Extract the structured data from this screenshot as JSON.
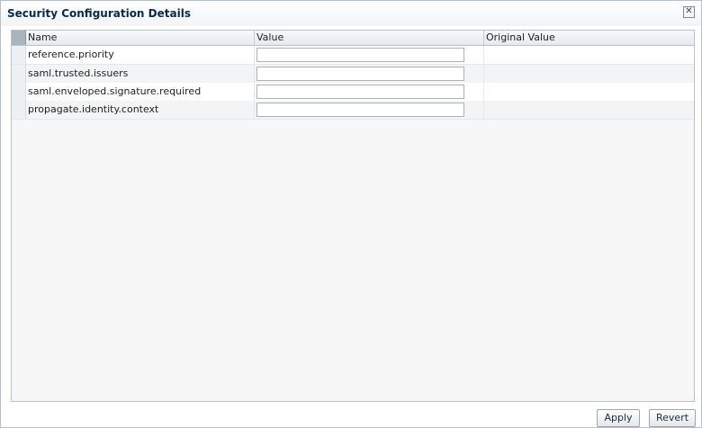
{
  "dialog": {
    "title": "Security Configuration Details",
    "close_glyph": "✕"
  },
  "table": {
    "columns": [
      "Name",
      "Value",
      "Original Value"
    ],
    "rows": [
      {
        "name": "reference.priority",
        "value": "",
        "original": ""
      },
      {
        "name": "saml.trusted.issuers",
        "value": "",
        "original": ""
      },
      {
        "name": "saml.enveloped.signature.required",
        "value": "",
        "original": ""
      },
      {
        "name": "propagate.identity.context",
        "value": "",
        "original": ""
      }
    ]
  },
  "buttons": {
    "apply": "Apply",
    "revert": "Revert"
  },
  "icons": {
    "close": "close-icon"
  },
  "colors": {
    "title": "#0a2a4a",
    "header_corner": "#aab4bd"
  }
}
